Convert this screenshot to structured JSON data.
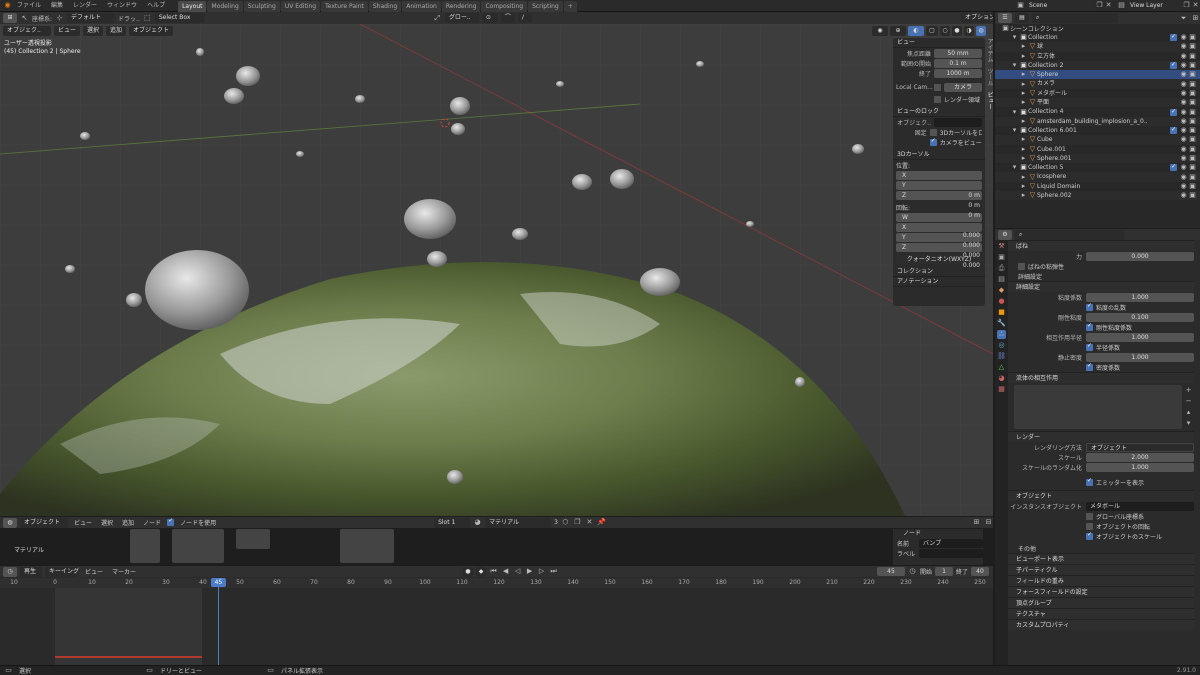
{
  "topbar": {
    "menus": [
      "ファイル",
      "編集",
      "レンダー",
      "ウィンドウ",
      "ヘルプ"
    ],
    "workspaces": [
      "Layout",
      "Modeling",
      "Sculpting",
      "UV Editing",
      "Texture Paint",
      "Shading",
      "Animation",
      "Rendering",
      "Compositing",
      "Scripting"
    ],
    "active_workspace": "Layout",
    "scene": "Scene",
    "view_layer": "View Layer"
  },
  "viewport": {
    "coord_label": "座標系:",
    "orientation": "デフォルト",
    "drag_label": "ドラッ..",
    "select_mode": "Select Box",
    "mode": "オブジェク..",
    "menus": [
      "ビュー",
      "選択",
      "追加",
      "オブジェクト"
    ],
    "transform_pivot": "グロー..",
    "options_label": "オプション",
    "overlay_line1": "ユーザー透視投影",
    "overlay_line2": "(45) Collection 2 | Sphere"
  },
  "npanel": {
    "view_header": "ビュー",
    "focal_label": "焦点距離",
    "focal_value": "50 mm",
    "clip_start_label": "範囲の開始",
    "clip_start_value": "0.1 m",
    "clip_end_label": "終了",
    "clip_end_value": "1000 m",
    "local_cam_label": "Local Cam...",
    "camera_value": "カメラ",
    "render_region_label": "レンダー領域",
    "view_lock_header": "ビューのロック",
    "lock_object_label": "オブジェク..",
    "lock_label": "固定",
    "lock_cursor_label": "3Dカーソルをロ..",
    "lock_camera_label": "カメラをビューに",
    "cursor_header": "3Dカーソル",
    "location_label": "位置:",
    "loc_x": "0 m",
    "loc_y": "0 m",
    "loc_z": "0 m",
    "rotation_label": "回転:",
    "rot_w": "0.000",
    "rot_x": "0.000",
    "rot_y": "0.000",
    "rot_z": "0.000",
    "rotation_mode": "クォータニオン(WXYZ)",
    "collection_header": "コレクション",
    "annotation_header": "アノテーション",
    "tabs": [
      "アイテム",
      "ツール",
      "ビュー"
    ]
  },
  "outliner": {
    "title": "シーンコレクション",
    "rows": [
      {
        "label": "Collection",
        "indent": 1,
        "sel": false
      },
      {
        "label": "球",
        "indent": 2,
        "sel": false
      },
      {
        "label": "立方体",
        "indent": 2,
        "sel": false
      },
      {
        "label": "Collection 2",
        "indent": 1,
        "sel": false
      },
      {
        "label": "Sphere",
        "indent": 2,
        "sel": true
      },
      {
        "label": "カメラ",
        "indent": 2,
        "sel": false
      },
      {
        "label": "メタボール",
        "indent": 2,
        "sel": false
      },
      {
        "label": "平面",
        "indent": 2,
        "sel": false
      },
      {
        "label": "Collection 4",
        "indent": 1,
        "sel": false
      },
      {
        "label": "amsterdam_building_implosion_a_0..",
        "indent": 2,
        "sel": false
      },
      {
        "label": "Collection 6.001",
        "indent": 1,
        "sel": false
      },
      {
        "label": "Cube",
        "indent": 2,
        "sel": false
      },
      {
        "label": "Cube.001",
        "indent": 2,
        "sel": false
      },
      {
        "label": "Sphere.001",
        "indent": 2,
        "sel": false
      },
      {
        "label": "Collection 5",
        "indent": 1,
        "sel": false
      },
      {
        "label": "Icosphere",
        "indent": 2,
        "sel": false
      },
      {
        "label": "Liquid Domain",
        "indent": 2,
        "sel": false
      },
      {
        "label": "Sphere.002",
        "indent": 2,
        "sel": false
      }
    ]
  },
  "props": {
    "spring_header": "ばね",
    "force_label": "力",
    "force_value": "0.000",
    "viscoelastic": "ばねの粘弾性",
    "advanced1": "詳細設定",
    "advanced2": "詳細設定",
    "viscosity_label": "粘度係数",
    "viscosity_value": "1.000",
    "viscosity_rand": "粘度の乱数",
    "stiffness_label": "剛性粘度",
    "stiffness_value": "0.100",
    "stiffness_rand": "剛性粘度係数",
    "radius_label": "相互作用半径",
    "radius_value": "1.000",
    "radius_check": "半径係数",
    "rest_label": "静止密度",
    "rest_value": "1.000",
    "rest_check": "密度係数",
    "fluid_interactions": "流体の相互作用",
    "render_header": "レンダー",
    "render_as_label": "レンダリング方法",
    "render_as_value": "オブジェクト",
    "scale_label": "スケール",
    "scale_value": "2.000",
    "scale_rand_label": "スケールのランダム化",
    "scale_rand_value": "1.000",
    "show_emitter": "エミッターを表示",
    "object_header": "オブジェクト",
    "instance_label": "インスタンスオブジェクト",
    "instance_value": "メタボール",
    "global_coords": "グローバル座標系",
    "object_rotation": "オブジェクトの回転",
    "object_scale": "オブジェクトのスケール",
    "other": "その他",
    "collapsed": [
      "ビューポート表示",
      "子パーティクル",
      "フィールドの重み",
      "フォースフィールドの設定",
      "頂点グループ",
      "テクスチャ",
      "カスタムプロパティ"
    ]
  },
  "node_editor": {
    "mode": "オブジェクト",
    "menus": [
      "ビュー",
      "選択",
      "追加",
      "ノード"
    ],
    "use_nodes": "ノードを使用",
    "slot": "Slot 1",
    "material": "マテリアル",
    "users": "3",
    "canvas_label": "マテリアル",
    "side_header": "ノード",
    "name_label": "名前",
    "name_value": "バンプ",
    "label_label": "ラベル"
  },
  "timeline": {
    "playback": "再生",
    "keying": "キーイング",
    "menus": [
      "ビュー",
      "マーカー"
    ],
    "current_frame": "45",
    "start_label": "開始",
    "start_value": "1",
    "end_label": "終了",
    "end_value": "40",
    "ruler": [
      "10",
      "0",
      "10",
      "20",
      "30",
      "40",
      "45",
      "50",
      "60",
      "70",
      "80",
      "90",
      "100",
      "110",
      "120",
      "130",
      "140",
      "150",
      "160",
      "170",
      "180",
      "190",
      "200",
      "210",
      "220",
      "230",
      "240",
      "250"
    ]
  },
  "statusbar": {
    "left": "選択",
    "mid": "ドリーとビュー",
    "right": "パネル拡張表示",
    "version": "2.91.0"
  }
}
